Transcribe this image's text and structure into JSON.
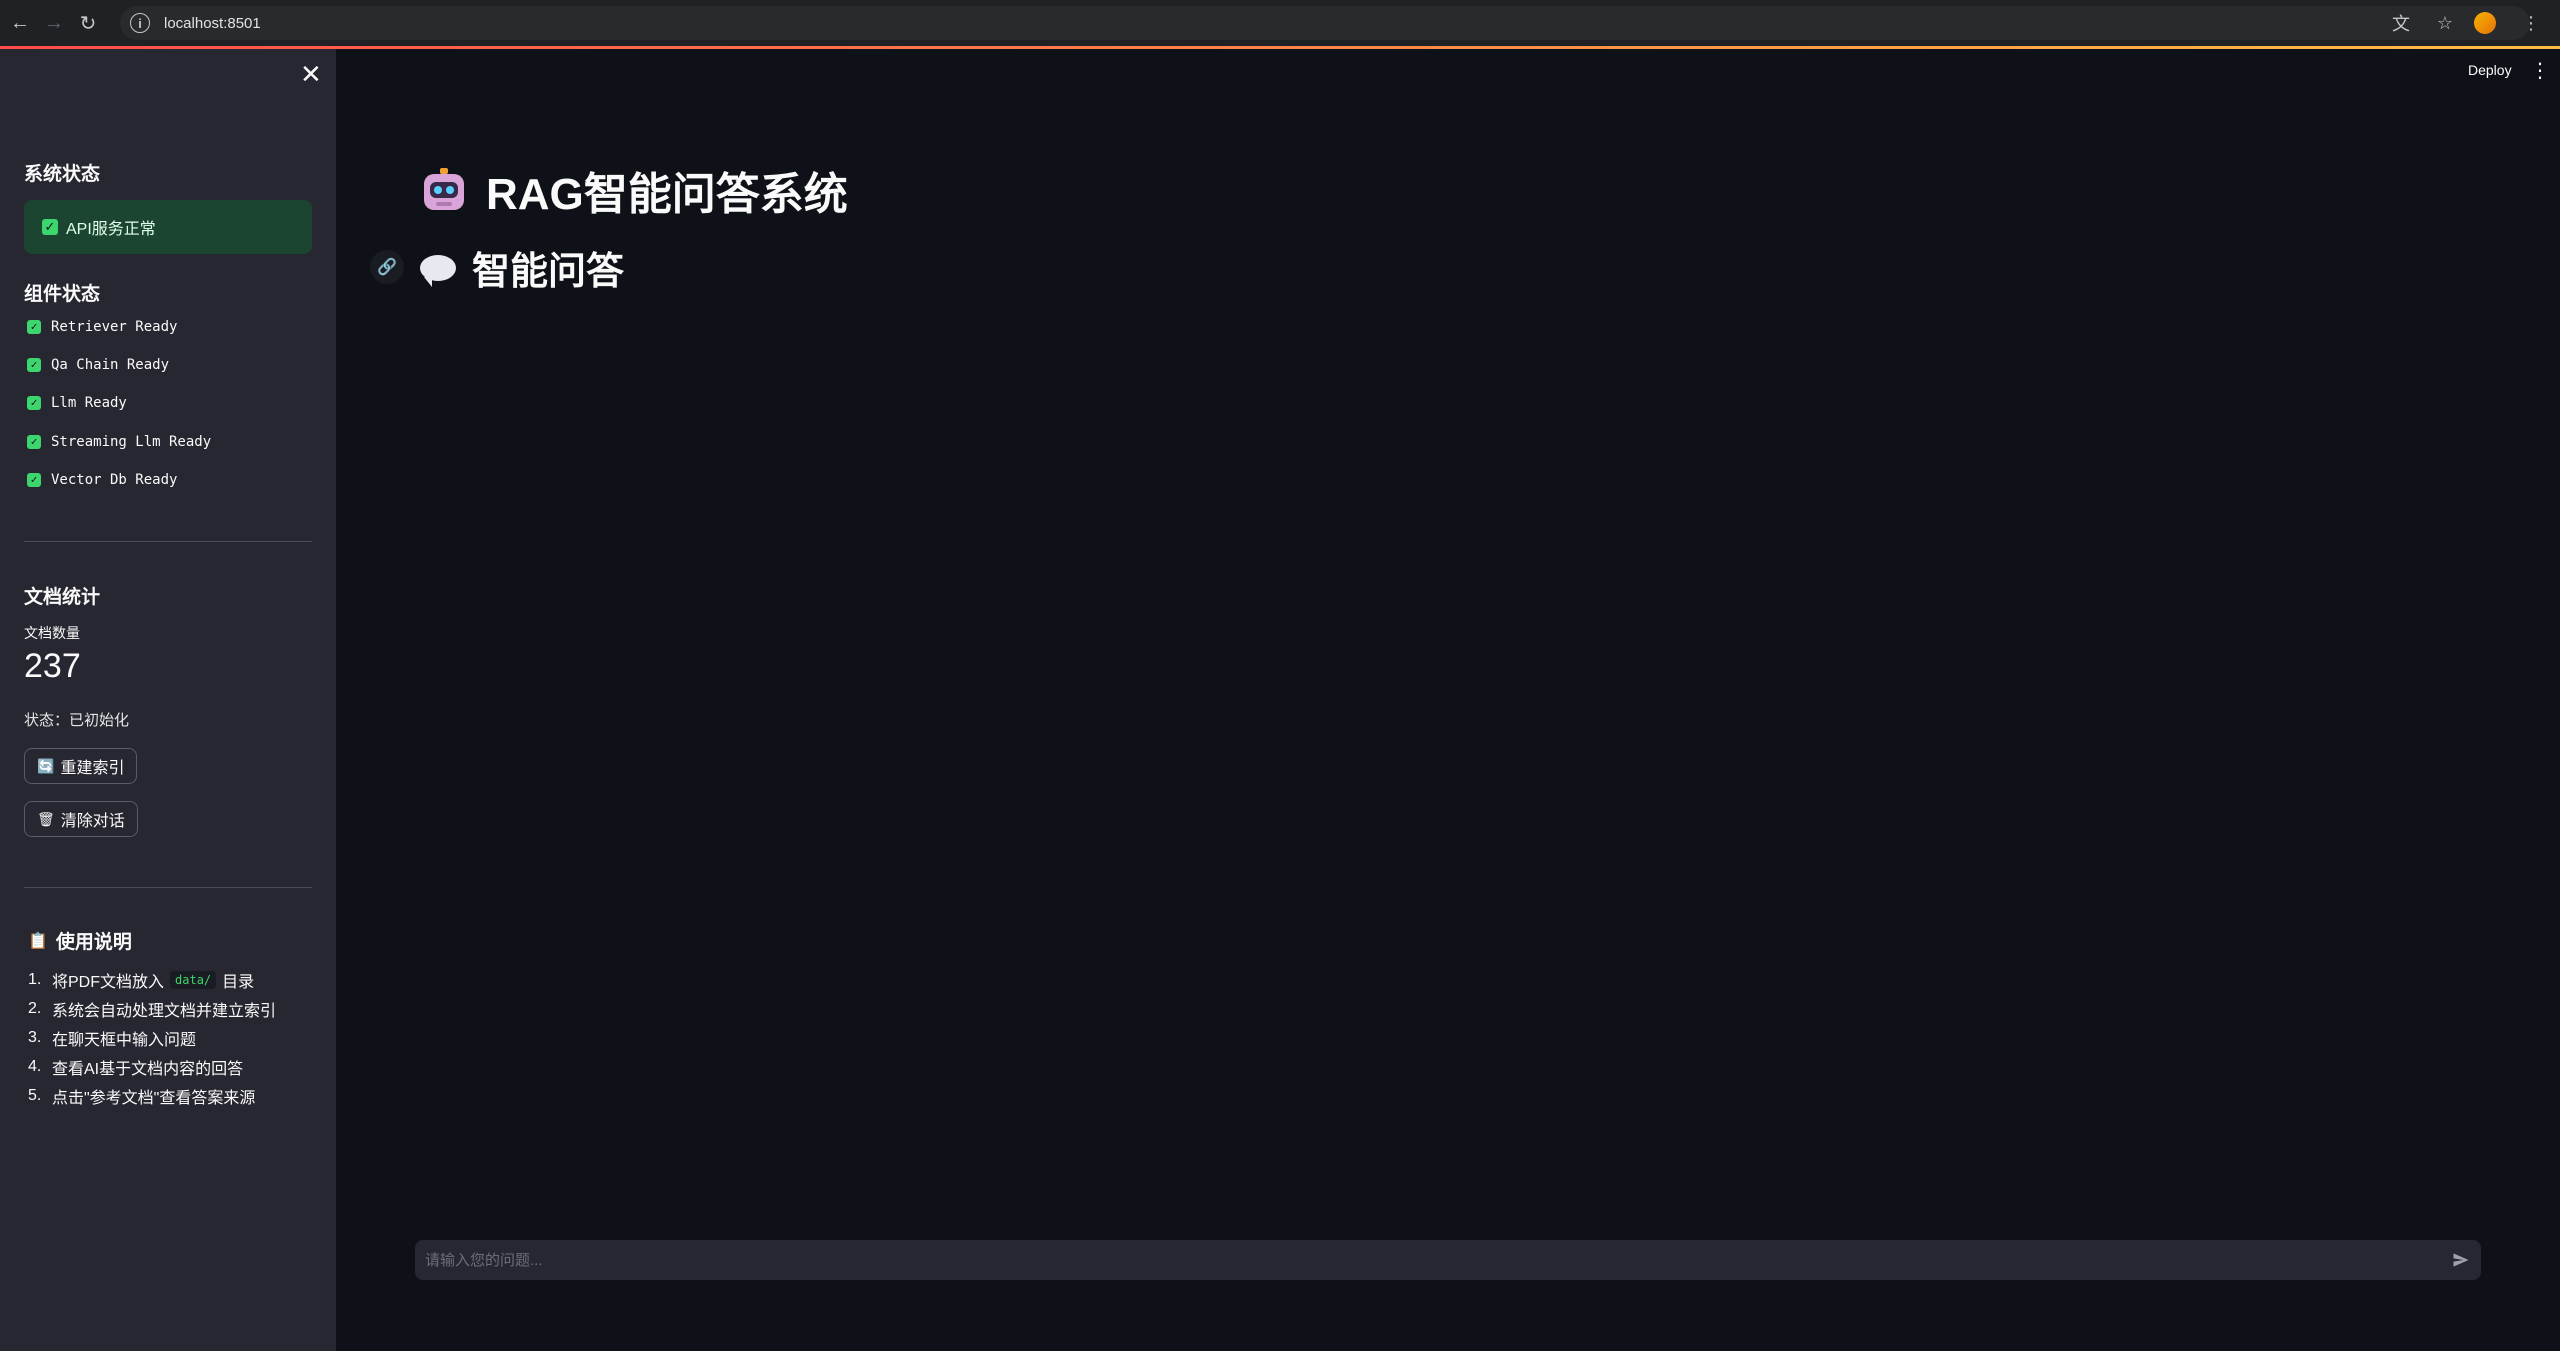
{
  "browser": {
    "url": "localhost:8501"
  },
  "sidebar": {
    "system_status_title": "系统状态",
    "api_status": "API服务正常",
    "component_status_title": "组件状态",
    "components": [
      "Retriever Ready",
      "Qa Chain Ready",
      "Llm Ready",
      "Streaming Llm Ready",
      "Vector Db Ready"
    ],
    "doc_stats_title": "文档统计",
    "doc_count_label": "文档数量",
    "doc_count_value": "237",
    "status_text": "状态：已初始化",
    "rebuild_button": "重建索引",
    "clear_button": "清除对话",
    "usage_title": "使用说明",
    "usage_steps": [
      {
        "num": "1.",
        "before": "将PDF文档放入",
        "code": "data/",
        "after": "目录"
      },
      {
        "num": "2.",
        "text": "系统会自动处理文档并建立索引"
      },
      {
        "num": "3.",
        "text": "在聊天框中输入问题"
      },
      {
        "num": "4.",
        "text": "查看AI基于文档内容的回答"
      },
      {
        "num": "5.",
        "text": "点击\"参考文档\"查看答案来源"
      }
    ]
  },
  "header": {
    "deploy_label": "Deploy"
  },
  "main": {
    "title": "RAG智能问答系统",
    "subtitle": "智能问答",
    "chat_placeholder": "请输入您的问题..."
  },
  "colors": {
    "background": "#0e1117",
    "sidebar": "#262730",
    "success_bg": "#1c4531",
    "success_check": "#3dd56d",
    "progress_start": "#ff4b4b",
    "progress_end": "#ffbd45"
  }
}
